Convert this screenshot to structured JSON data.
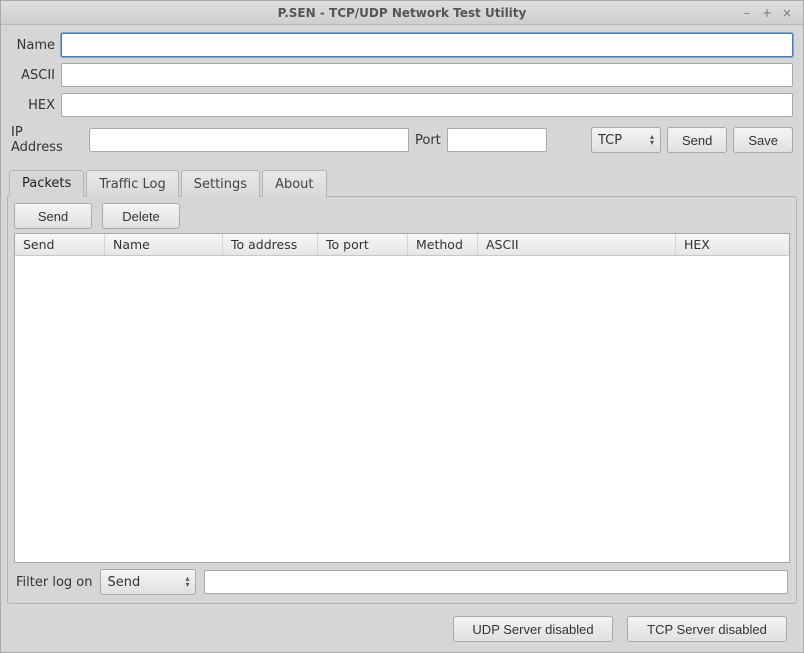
{
  "window": {
    "title": "P.SEN - TCP/UDP Network Test Utility"
  },
  "form": {
    "name_label": "Name",
    "name_value": "",
    "ascii_label": "ASCII",
    "ascii_value": "",
    "hex_label": "HEX",
    "hex_value": "",
    "ip_label": "IP Address",
    "ip_value": "",
    "port_label": "Port",
    "port_value": "",
    "protocol_value": "TCP",
    "send_label": "Send",
    "save_label": "Save"
  },
  "tabs": [
    {
      "label": "Packets"
    },
    {
      "label": "Traffic Log"
    },
    {
      "label": "Settings"
    },
    {
      "label": "About"
    }
  ],
  "panel": {
    "send_btn": "Send",
    "delete_btn": "Delete",
    "columns": [
      "Send",
      "Name",
      "To address",
      "To port",
      "Method",
      "ASCII",
      "HEX"
    ],
    "rows": []
  },
  "filter": {
    "label": "Filter log on",
    "selected": "Send",
    "text_value": ""
  },
  "footer": {
    "udp_btn": "UDP Server disabled",
    "tcp_btn": "TCP Server disabled"
  }
}
